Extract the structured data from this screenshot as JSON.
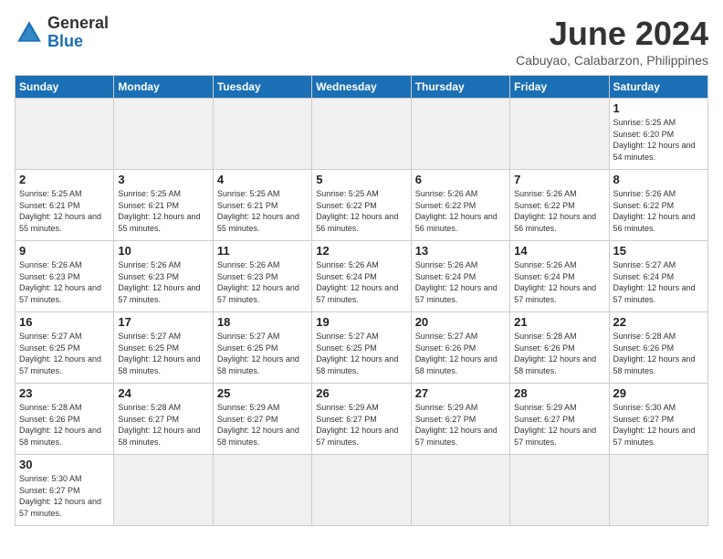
{
  "logo": {
    "general": "General",
    "blue": "Blue"
  },
  "header": {
    "title": "June 2024",
    "subtitle": "Cabuyao, Calabarzon, Philippines"
  },
  "weekdays": [
    "Sunday",
    "Monday",
    "Tuesday",
    "Wednesday",
    "Thursday",
    "Friday",
    "Saturday"
  ],
  "days": {
    "1": {
      "sunrise": "5:25 AM",
      "sunset": "6:20 PM",
      "daylight": "12 hours and 54 minutes."
    },
    "2": {
      "sunrise": "5:25 AM",
      "sunset": "6:21 PM",
      "daylight": "12 hours and 55 minutes."
    },
    "3": {
      "sunrise": "5:25 AM",
      "sunset": "6:21 PM",
      "daylight": "12 hours and 55 minutes."
    },
    "4": {
      "sunrise": "5:25 AM",
      "sunset": "6:21 PM",
      "daylight": "12 hours and 55 minutes."
    },
    "5": {
      "sunrise": "5:25 AM",
      "sunset": "6:22 PM",
      "daylight": "12 hours and 56 minutes."
    },
    "6": {
      "sunrise": "5:26 AM",
      "sunset": "6:22 PM",
      "daylight": "12 hours and 56 minutes."
    },
    "7": {
      "sunrise": "5:26 AM",
      "sunset": "6:22 PM",
      "daylight": "12 hours and 56 minutes."
    },
    "8": {
      "sunrise": "5:26 AM",
      "sunset": "6:22 PM",
      "daylight": "12 hours and 56 minutes."
    },
    "9": {
      "sunrise": "5:26 AM",
      "sunset": "6:23 PM",
      "daylight": "12 hours and 57 minutes."
    },
    "10": {
      "sunrise": "5:26 AM",
      "sunset": "6:23 PM",
      "daylight": "12 hours and 57 minutes."
    },
    "11": {
      "sunrise": "5:26 AM",
      "sunset": "6:23 PM",
      "daylight": "12 hours and 57 minutes."
    },
    "12": {
      "sunrise": "5:26 AM",
      "sunset": "6:24 PM",
      "daylight": "12 hours and 57 minutes."
    },
    "13": {
      "sunrise": "5:26 AM",
      "sunset": "6:24 PM",
      "daylight": "12 hours and 57 minutes."
    },
    "14": {
      "sunrise": "5:26 AM",
      "sunset": "6:24 PM",
      "daylight": "12 hours and 57 minutes."
    },
    "15": {
      "sunrise": "5:27 AM",
      "sunset": "6:24 PM",
      "daylight": "12 hours and 57 minutes."
    },
    "16": {
      "sunrise": "5:27 AM",
      "sunset": "6:25 PM",
      "daylight": "12 hours and 57 minutes."
    },
    "17": {
      "sunrise": "5:27 AM",
      "sunset": "6:25 PM",
      "daylight": "12 hours and 58 minutes."
    },
    "18": {
      "sunrise": "5:27 AM",
      "sunset": "6:25 PM",
      "daylight": "12 hours and 58 minutes."
    },
    "19": {
      "sunrise": "5:27 AM",
      "sunset": "6:25 PM",
      "daylight": "12 hours and 58 minutes."
    },
    "20": {
      "sunrise": "5:27 AM",
      "sunset": "6:26 PM",
      "daylight": "12 hours and 58 minutes."
    },
    "21": {
      "sunrise": "5:28 AM",
      "sunset": "6:26 PM",
      "daylight": "12 hours and 58 minutes."
    },
    "22": {
      "sunrise": "5:28 AM",
      "sunset": "6:26 PM",
      "daylight": "12 hours and 58 minutes."
    },
    "23": {
      "sunrise": "5:28 AM",
      "sunset": "6:26 PM",
      "daylight": "12 hours and 58 minutes."
    },
    "24": {
      "sunrise": "5:28 AM",
      "sunset": "6:27 PM",
      "daylight": "12 hours and 58 minutes."
    },
    "25": {
      "sunrise": "5:29 AM",
      "sunset": "6:27 PM",
      "daylight": "12 hours and 58 minutes."
    },
    "26": {
      "sunrise": "5:29 AM",
      "sunset": "6:27 PM",
      "daylight": "12 hours and 57 minutes."
    },
    "27": {
      "sunrise": "5:29 AM",
      "sunset": "6:27 PM",
      "daylight": "12 hours and 57 minutes."
    },
    "28": {
      "sunrise": "5:29 AM",
      "sunset": "6:27 PM",
      "daylight": "12 hours and 57 minutes."
    },
    "29": {
      "sunrise": "5:30 AM",
      "sunset": "6:27 PM",
      "daylight": "12 hours and 57 minutes."
    },
    "30": {
      "sunrise": "5:30 AM",
      "sunset": "6:27 PM",
      "daylight": "12 hours and 57 minutes."
    }
  }
}
